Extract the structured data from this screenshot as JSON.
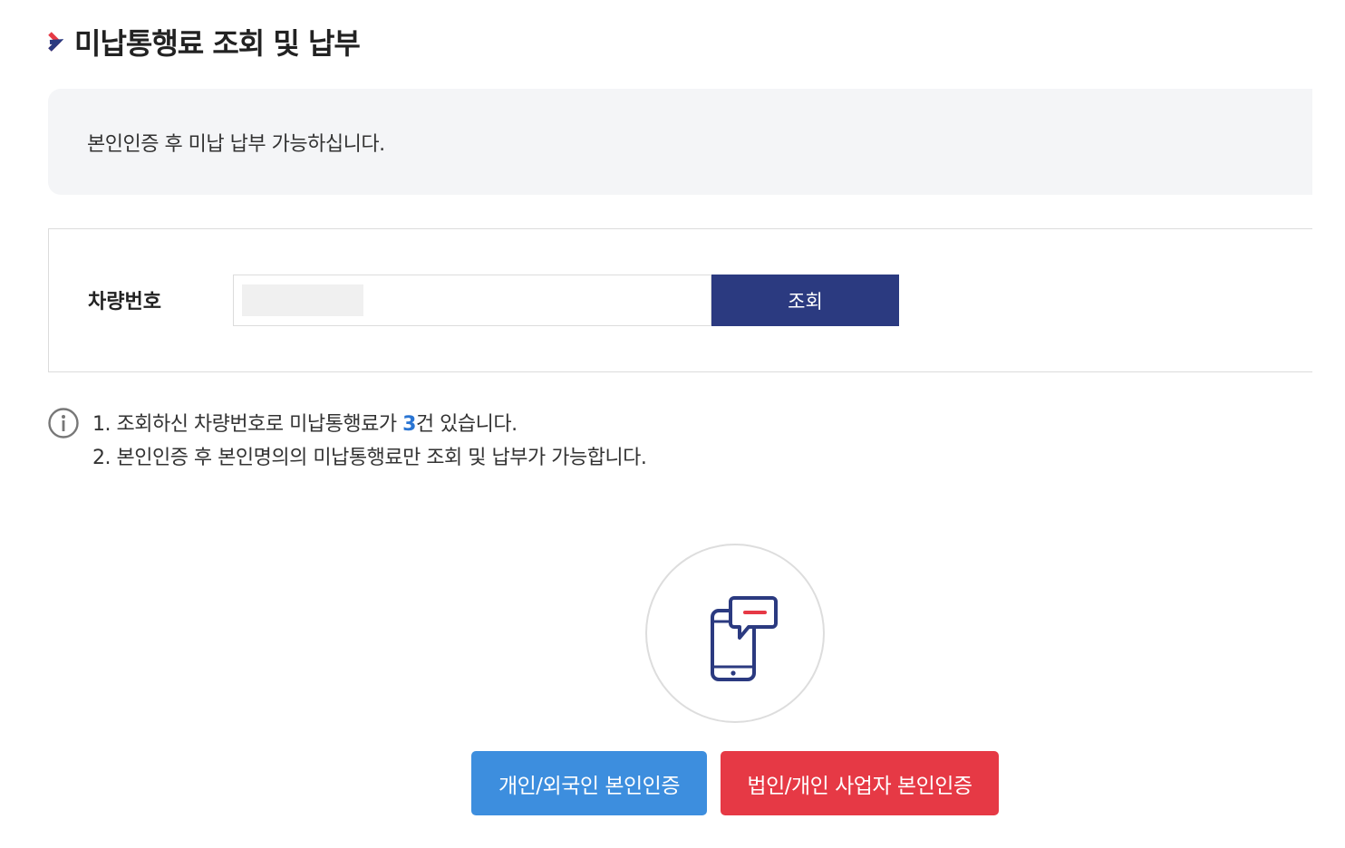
{
  "header": {
    "title": "미납통행료 조회 및 납부",
    "chevron_icon": "chevron-right-icon",
    "chevron_color": "#e63945",
    "chevron_color_2": "#2b3a80"
  },
  "notice": {
    "text": "본인인증 후 미납 납부 가능하십니다."
  },
  "search": {
    "label": "차량번호",
    "input_value": "",
    "button_label": "조회",
    "button_color": "#2b3a80"
  },
  "info": {
    "icon": "info-circle-icon",
    "line1_prefix": "1. 조회하신 차량번호로 미납통행료가 ",
    "line1_count": "3",
    "line1_suffix": "건 있습니다.",
    "line2": "2. 본인인증 후 본인명의의 미납통행료만 조회 및 납부가 가능합니다.",
    "count_color": "#2a75d3"
  },
  "auth": {
    "icon": "phone-message-icon",
    "personal_label": "개인/외국인 본인인증",
    "personal_color": "#3d8ede",
    "business_label": "법인/개인 사업자 본인인증",
    "business_color": "#e63945"
  }
}
